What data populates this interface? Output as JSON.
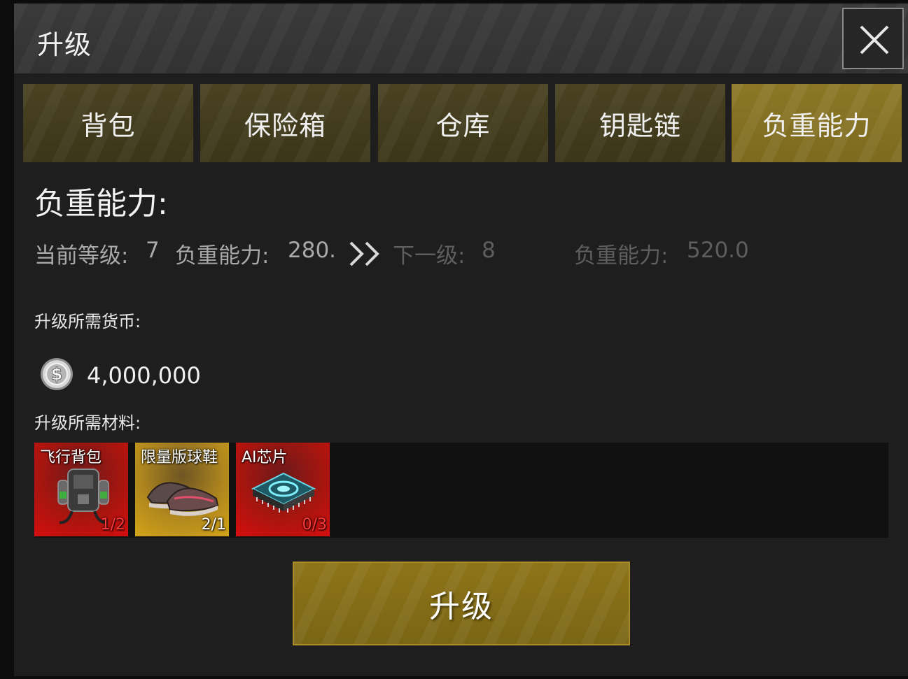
{
  "header": {
    "title": "升级",
    "close_icon": "close-icon"
  },
  "tabs": [
    {
      "label": "背包",
      "active": false
    },
    {
      "label": "保险箱",
      "active": false
    },
    {
      "label": "仓库",
      "active": false
    },
    {
      "label": "钥匙链",
      "active": false
    },
    {
      "label": "负重能力",
      "active": true
    }
  ],
  "section": {
    "title": "负重能力:"
  },
  "current": {
    "level_label": "当前等级:",
    "level_value": "7",
    "capacity_label": "负重能力:",
    "capacity_value": "280."
  },
  "next": {
    "level_label": "下一级:",
    "level_value": "8",
    "capacity_label": "负重能力:",
    "capacity_value": "520.0"
  },
  "currency": {
    "label": "升级所需货币:",
    "icon": "silver-coin-icon",
    "amount": "4,000,000"
  },
  "materials": {
    "label": "升级所需材料:",
    "items": [
      {
        "name": "飞行背包",
        "count": "1/2",
        "rarity_color": "#c8110c",
        "icon": "jetpack-icon",
        "sufficient": false
      },
      {
        "name": "限量版球鞋",
        "count": "2/1",
        "rarity_color": "#c9991a",
        "icon": "sneakers-icon",
        "sufficient": true
      },
      {
        "name": "AI芯片",
        "count": "0/3",
        "rarity_color": "#c8110c",
        "icon": "chip-icon",
        "sufficient": false
      }
    ]
  },
  "upgrade_button": {
    "label": "升级"
  },
  "colors": {
    "accent_gold": "#8c7726",
    "tab_inactive": "#433c1e",
    "shortage_red": "#ff3a3a"
  }
}
